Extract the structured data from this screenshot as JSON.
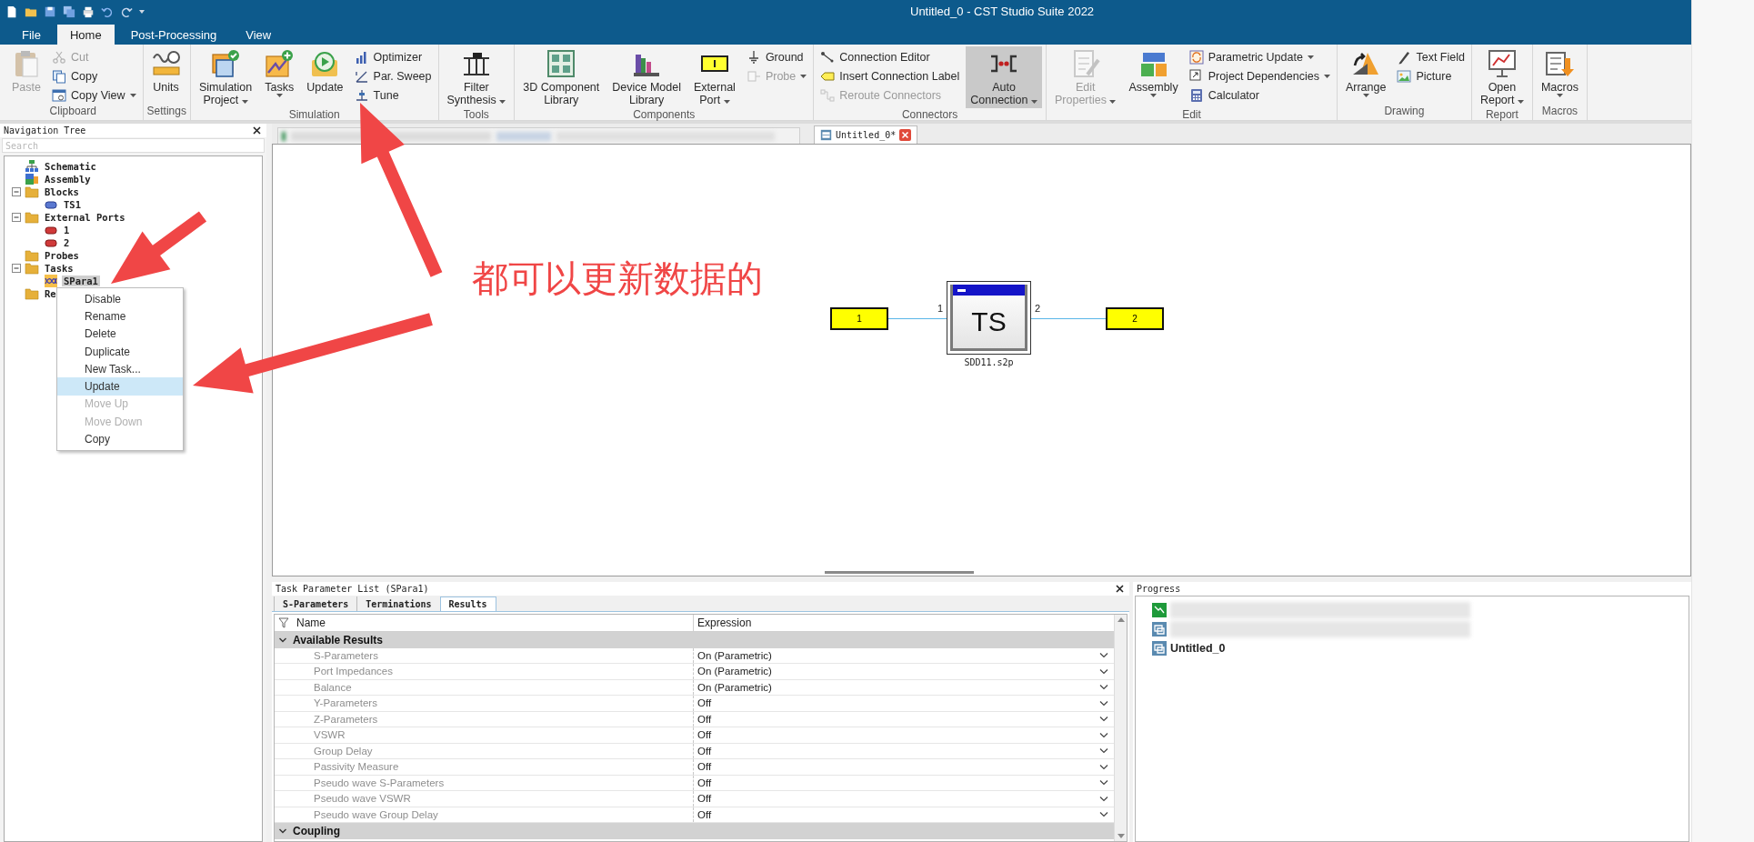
{
  "window": {
    "title": "Untitled_0 - CST Studio Suite 2022"
  },
  "menu_tabs": [
    {
      "label": "File",
      "selected": false
    },
    {
      "label": "Home",
      "selected": true
    },
    {
      "label": "Post-Processing",
      "selected": false
    },
    {
      "label": "View",
      "selected": false
    }
  ],
  "ribbon": [
    {
      "label": "Clipboard",
      "items": [
        {
          "kind": "large",
          "label": "Paste",
          "dropdown": false,
          "disabled": true,
          "pressed": false
        },
        {
          "kind": "stack",
          "items": [
            {
              "label": "Cut",
              "dropdown": false,
              "disabled": true
            },
            {
              "label": "Copy",
              "dropdown": false,
              "disabled": false
            },
            {
              "label": "Copy View",
              "dropdown": true,
              "disabled": false
            }
          ]
        }
      ]
    },
    {
      "label": "Settings",
      "items": [
        {
          "kind": "large",
          "label": "Units",
          "dropdown": false,
          "disabled": false,
          "pressed": false
        }
      ]
    },
    {
      "label": "Simulation",
      "items": [
        {
          "kind": "large",
          "label": "Simulation\nProject",
          "dropdown": true,
          "disabled": false,
          "pressed": false
        },
        {
          "kind": "large",
          "label": "Tasks",
          "dropdown": true,
          "disabled": false,
          "pressed": false
        },
        {
          "kind": "large",
          "label": "Update",
          "dropdown": false,
          "disabled": false,
          "pressed": false
        },
        {
          "kind": "stack",
          "items": [
            {
              "label": "Optimizer",
              "dropdown": false,
              "disabled": false
            },
            {
              "label": "Par. Sweep",
              "dropdown": false,
              "disabled": false
            },
            {
              "label": "Tune",
              "dropdown": false,
              "disabled": false
            }
          ]
        }
      ]
    },
    {
      "label": "Tools",
      "items": [
        {
          "kind": "large",
          "label": "Filter\nSynthesis",
          "dropdown": true,
          "disabled": false,
          "pressed": false
        }
      ]
    },
    {
      "label": "Components",
      "items": [
        {
          "kind": "large",
          "label": "3D Component\nLibrary",
          "dropdown": false,
          "disabled": false,
          "pressed": false
        },
        {
          "kind": "large",
          "label": "Device Model\nLibrary",
          "dropdown": false,
          "disabled": false,
          "pressed": false
        },
        {
          "kind": "large",
          "label": "External\nPort",
          "dropdown": true,
          "disabled": false,
          "pressed": false
        },
        {
          "kind": "stack",
          "items": [
            {
              "label": "Ground",
              "dropdown": false,
              "disabled": false
            },
            {
              "label": "Probe",
              "dropdown": true,
              "disabled": true
            }
          ]
        }
      ]
    },
    {
      "label": "Connectors",
      "items": [
        {
          "kind": "stack",
          "items": [
            {
              "label": "Connection Editor",
              "dropdown": false,
              "disabled": false
            },
            {
              "label": "Insert Connection Label",
              "dropdown": false,
              "disabled": false
            },
            {
              "label": "Reroute Connectors",
              "dropdown": false,
              "disabled": true
            }
          ]
        },
        {
          "kind": "large",
          "label": "Auto\nConnection",
          "dropdown": true,
          "disabled": false,
          "pressed": true
        }
      ]
    },
    {
      "label": "Edit",
      "items": [
        {
          "kind": "large",
          "label": "Edit\nProperties",
          "dropdown": true,
          "disabled": true,
          "pressed": false
        },
        {
          "kind": "large",
          "label": "Assembly",
          "dropdown": true,
          "disabled": false,
          "pressed": false
        },
        {
          "kind": "stack",
          "items": [
            {
              "label": "Parametric Update",
              "dropdown": true,
              "disabled": false
            },
            {
              "label": "Project Dependencies",
              "dropdown": true,
              "disabled": false
            },
            {
              "label": "Calculator",
              "dropdown": false,
              "disabled": false
            }
          ]
        }
      ]
    },
    {
      "label": "Drawing",
      "items": [
        {
          "kind": "large",
          "label": "Arrange",
          "dropdown": true,
          "disabled": false,
          "pressed": false
        },
        {
          "kind": "stack",
          "items": [
            {
              "label": "Text Field",
              "dropdown": false,
              "disabled": false
            },
            {
              "label": "Picture",
              "dropdown": false,
              "disabled": false
            }
          ]
        }
      ]
    },
    {
      "label": "Report",
      "items": [
        {
          "kind": "large",
          "label": "Open\nReport",
          "dropdown": true,
          "disabled": false,
          "pressed": false
        }
      ]
    },
    {
      "label": "Macros",
      "items": [
        {
          "kind": "large",
          "label": "Macros",
          "dropdown": true,
          "disabled": false,
          "pressed": false
        }
      ]
    }
  ],
  "navigation_tree": {
    "title": "Navigation Tree",
    "search": {
      "placeholder": "Search"
    },
    "items": [
      {
        "kind": "schematic",
        "label": "Schematic",
        "selected": false
      },
      {
        "kind": "assembly",
        "label": "Assembly",
        "selected": false
      },
      {
        "kind": "folder",
        "label": "Blocks",
        "selected": false,
        "expanded": true,
        "children": [
          {
            "kind": "block",
            "label": "TS1",
            "selected": false
          }
        ]
      },
      {
        "kind": "folder",
        "label": "External Ports",
        "selected": false,
        "expanded": true,
        "children": [
          {
            "kind": "port",
            "label": "1",
            "selected": false
          },
          {
            "kind": "port",
            "label": "2",
            "selected": false
          }
        ]
      },
      {
        "kind": "folder",
        "label": "Probes",
        "selected": false
      },
      {
        "kind": "folder",
        "label": "Tasks",
        "selected": false,
        "expanded": true,
        "children": [
          {
            "kind": "task",
            "label": "SPara1",
            "selected": true
          }
        ]
      },
      {
        "kind": "folder",
        "label": "Re",
        "selected": false
      }
    ]
  },
  "context_menu": [
    {
      "label": "Disable",
      "disabled": false,
      "selected": false
    },
    {
      "label": "Rename",
      "disabled": false,
      "selected": false
    },
    {
      "label": "Delete",
      "disabled": false,
      "selected": false
    },
    {
      "label": "Duplicate",
      "disabled": false,
      "selected": false
    },
    {
      "label": "New Task...",
      "disabled": false,
      "selected": false
    },
    {
      "label": "Update",
      "disabled": false,
      "selected": true
    },
    {
      "label": "Move Up",
      "disabled": true,
      "selected": false
    },
    {
      "label": "Move Down",
      "disabled": true,
      "selected": false
    },
    {
      "label": "Copy",
      "disabled": false,
      "selected": false
    }
  ],
  "doc_tabs": [
    {
      "kind": "redacted",
      "selected": false
    },
    {
      "kind": "document",
      "label": "Untitled_0*",
      "selected": true
    }
  ],
  "schematic": {
    "ports": [
      {
        "label": "1"
      },
      {
        "label": "2"
      }
    ],
    "block": {
      "label": "TS",
      "file": "SDD11.s2p",
      "pins": [
        "1",
        "2"
      ]
    }
  },
  "task_parameters": {
    "title": "Task Parameter List (SPara1)",
    "tabs": [
      {
        "label": "S-Parameters",
        "selected": false
      },
      {
        "label": "Terminations",
        "selected": false
      },
      {
        "label": "Results",
        "selected": true
      }
    ],
    "columns": [
      "Name",
      "Expression"
    ],
    "sections": [
      {
        "label": "Available Results",
        "expanded": true,
        "rows": [
          {
            "name": "S-Parameters",
            "value": "On (Parametric)"
          },
          {
            "name": "Port Impedances",
            "value": "On (Parametric)"
          },
          {
            "name": "Balance",
            "value": "On (Parametric)"
          },
          {
            "name": "Y-Parameters",
            "value": "Off"
          },
          {
            "name": "Z-Parameters",
            "value": "Off"
          },
          {
            "name": "VSWR",
            "value": "Off"
          },
          {
            "name": "Group Delay",
            "value": "Off"
          },
          {
            "name": "Passivity Measure",
            "value": "Off"
          },
          {
            "name": "Pseudo wave S-Parameters",
            "value": "Off"
          },
          {
            "name": "Pseudo wave VSWR",
            "value": "Off"
          },
          {
            "name": "Pseudo wave Group Delay",
            "value": "Off"
          }
        ]
      },
      {
        "label": "Coupling",
        "expanded": true
      }
    ]
  },
  "progress": {
    "title": "Progress",
    "items": [
      {
        "kind": "redacted"
      },
      {
        "kind": "redacted"
      },
      {
        "kind": "project",
        "label": "Untitled_0"
      }
    ]
  },
  "annotation": {
    "text": "都可以更新数据的"
  }
}
